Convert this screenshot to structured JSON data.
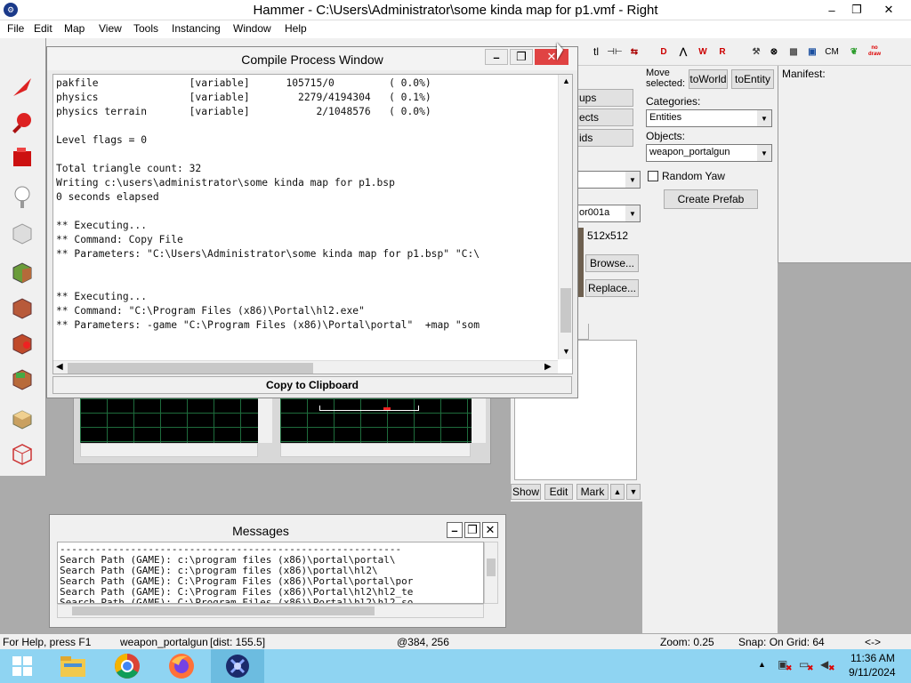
{
  "window": {
    "title": "Hammer - C:\\Users\\Administrator\\some kinda map for p1.vmf - Right",
    "minimize": "–",
    "restore": "❐",
    "close": "✕"
  },
  "menu": [
    "File",
    "Edit",
    "Map",
    "View",
    "Tools",
    "Instancing",
    "Window",
    "Help"
  ],
  "toolbar": {
    "tl": "tl",
    "cm": "CM",
    "nodraw": "no draw"
  },
  "compile": {
    "title": "Compile Process Window",
    "log": "pakfile               [variable]      105715/0         ( 0.0%)\nphysics               [variable]        2279/4194304   ( 0.1%)\nphysics terrain       [variable]           2/1048576   ( 0.0%)\n\nLevel flags = 0\n\nTotal triangle count: 32\nWriting c:\\users\\administrator\\some kinda map for p1.bsp\n0 seconds elapsed\n\n** Executing...\n** Command: Copy File\n** Parameters: \"C:\\Users\\Administrator\\some kinda map for p1.bsp\" \"C:\\\n\n\n** Executing...\n** Command: \"C:\\Program Files (x86)\\Portal\\hl2.exe\"\n** Parameters: -game \"C:\\Program Files (x86)\\Portal\\portal\"  +map \"som",
    "copy_button": "Copy to Clipboard"
  },
  "partial_panel": {
    "groups": "ups",
    "objects": "ects",
    "solids": "ids",
    "texture": "or001a",
    "size": "512x512",
    "browse": "Browse...",
    "replace": "Replace..."
  },
  "entity_panel": {
    "move_selected": "Move selected:",
    "to_world": "toWorld",
    "to_entity": "toEntity",
    "categories_label": "Categories:",
    "categories_value": "Entities",
    "objects_label": "Objects:",
    "objects_value": "weapon_portalgun",
    "random_yaw": "Random Yaw",
    "create_prefab": "Create Prefab"
  },
  "manifest": {
    "label": "Manifest:"
  },
  "visgroup_buttons": {
    "show": "Show",
    "edit": "Edit",
    "mark": "Mark",
    "up": "▲",
    "down": "▼"
  },
  "messages": {
    "title": "Messages",
    "log": "----------------------------------------------------------\nSearch Path (GAME): c:\\program files (x86)\\portal\\portal\\\nSearch Path (GAME): c:\\program files (x86)\\portal\\hl2\\\nSearch Path (GAME): C:\\Program Files (x86)\\Portal\\portal\\por\nSearch Path (GAME): C:\\Program Files (x86)\\Portal\\hl2\\hl2_te\nSearch Path (GAME): C:\\Program Files (x86)\\Portal\\hl2\\hl2_so"
  },
  "status": {
    "help": "For Help, press F1",
    "selection": "weapon_portalgun",
    "dist": "[dist: 155.5]",
    "coords": "@384, 256",
    "zoom": "Zoom: 0.25",
    "snap": "Snap: On Grid: 64",
    "arrows": "<->"
  },
  "taskbar": {
    "time": "11:36 AM",
    "date": "9/11/2024"
  },
  "colors": {
    "close_red": "#e04343",
    "taskbar": "#8fd4f2",
    "viewport_bg": "#000000",
    "grid": "#1e6b3c"
  }
}
